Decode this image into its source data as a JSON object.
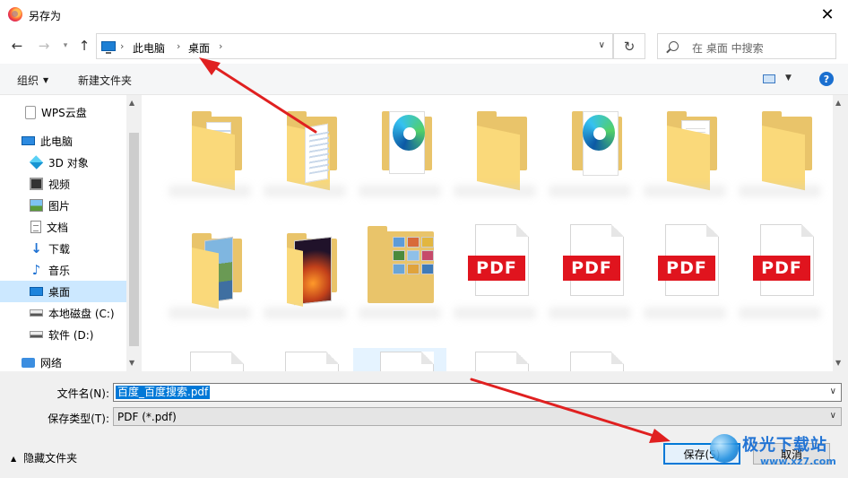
{
  "window": {
    "title": "另存为"
  },
  "breadcrumb": {
    "items": [
      "此电脑",
      "桌面"
    ]
  },
  "search": {
    "placeholder": "在 桌面 中搜索"
  },
  "toolbar": {
    "organize_label": "组织",
    "new_folder_label": "新建文件夹",
    "help_label": "?"
  },
  "sidebar": {
    "items": [
      {
        "label": "WPS云盘",
        "icon": "cloud-icon"
      },
      {
        "label": "此电脑",
        "icon": "computer-icon"
      },
      {
        "label": "3D 对象",
        "icon": "3d-objects-icon"
      },
      {
        "label": "视频",
        "icon": "video-icon"
      },
      {
        "label": "图片",
        "icon": "pictures-icon"
      },
      {
        "label": "文档",
        "icon": "documents-icon"
      },
      {
        "label": "下载",
        "icon": "download-icon"
      },
      {
        "label": "音乐",
        "icon": "music-icon"
      },
      {
        "label": "桌面",
        "icon": "desktop-icon",
        "selected": true
      },
      {
        "label": "本地磁盘 (C:)",
        "icon": "drive-icon"
      },
      {
        "label": "软件 (D:)",
        "icon": "drive-icon"
      },
      {
        "label": "网络",
        "icon": "network-icon"
      }
    ]
  },
  "files": {
    "pdf_badge": "PDF",
    "row1": [
      "folder-docs",
      "folder-docs",
      "folder-edge",
      "folder-plain",
      "folder-edge",
      "folder-docs",
      "folder-plain"
    ],
    "row2": [
      "folder-landscape",
      "folder-fire",
      "folder-collage",
      "pdf",
      "pdf",
      "pdf",
      "pdf"
    ]
  },
  "form": {
    "filename_label": "文件名(N):",
    "filename_value": "百度_百度搜索.pdf",
    "filetype_label": "保存类型(T):",
    "filetype_value": "PDF (*.pdf)",
    "hide_folders_label": "隐藏文件夹",
    "save_label": "保存(S)",
    "cancel_label": "取消"
  },
  "watermark": {
    "text": "极光下载站",
    "url": "www.xz7.com"
  },
  "colors": {
    "accent": "#0078d7",
    "selection": "#cce8ff",
    "annotation_arrow": "#e02020"
  }
}
